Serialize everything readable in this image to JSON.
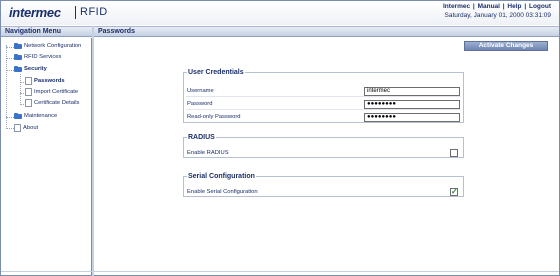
{
  "header": {
    "logo": "intermec",
    "product": "RFID",
    "links": [
      "Intermec",
      "Manual",
      "Help",
      "Logout"
    ],
    "date": "Saturday, January 01, 2000 03:31:09"
  },
  "nav": {
    "title": "Navigation Menu",
    "items": [
      {
        "label": "Network Configuration"
      },
      {
        "label": "RFID Services"
      },
      {
        "label": "Security"
      },
      {
        "label": "Passwords"
      },
      {
        "label": "Import Certificate"
      },
      {
        "label": "Certificate Details"
      },
      {
        "label": "Maintenance"
      },
      {
        "label": "About"
      }
    ]
  },
  "content": {
    "title": "Passwords",
    "activate_label": "Activate Changes",
    "user_credentials": {
      "legend": "User Credentials",
      "username_label": "Username",
      "username_value": "intermec",
      "password_label": "Password",
      "password_value": "●●●●●●●●",
      "readonly_label": "Read-only Password",
      "readonly_value": "●●●●●●●●"
    },
    "radius": {
      "legend": "RADIUS",
      "enable_label": "Enable RADIUS",
      "enabled": false
    },
    "serial": {
      "legend": "Serial Configuration",
      "enable_label": "Enable Serial Configuration",
      "enabled": true
    }
  },
  "colors": {
    "brand": "#1b2f6b",
    "folder": "#3a73c9",
    "button": "#7f93bd"
  }
}
